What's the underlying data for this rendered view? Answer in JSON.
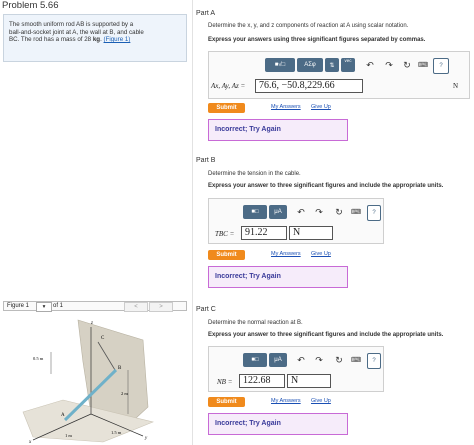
{
  "problem": {
    "title": "Problem 5.66",
    "text_line1": "The smooth uniform rod AB is supported by a",
    "text_line2": "ball-and-socket joint at A, the wall at B, and cable",
    "text_line3_a": "BC. The rod has a mass of 28",
    "text_line3_unit": "kg",
    "text_line3_b": ".",
    "figure_link": "(Figure 1)"
  },
  "figure": {
    "label": "Figure 1",
    "page": "1",
    "of": "of 1",
    "prev": "<",
    "next": ">",
    "labels": {
      "z": "z",
      "c": "C",
      "b": "B",
      "a": "A",
      "d1": "0.5 m",
      "d2": "2 m",
      "d3": "1 m",
      "d4": "1.5 m",
      "x": "x",
      "y": "y"
    }
  },
  "partA": {
    "title": "Part A",
    "description": "Determine the x, y, and z components of reaction at A using scalar notation.",
    "instruction": "Express your answers using three significant figures separated by commas.",
    "toolbar": {
      "templates": "■√□",
      "symbols": "ΑΣφ",
      "vec": "⇅",
      "vec2": "vec",
      "help": "?"
    },
    "label": "Ax, Ay, Az =",
    "value": "76.6, −50.8,229.66",
    "unit": "N",
    "submit": "Submit",
    "my_answers": "My Answers",
    "give_up": "Give Up",
    "feedback": "Incorrect; Try Again"
  },
  "partB": {
    "title": "Part B",
    "description": "Determine the tension in the cable.",
    "instruction": "Express your answer to three significant figures and include the appropriate units.",
    "toolbar": {
      "templates": "■□",
      "units": "μA",
      "help": "?"
    },
    "label": "TBC =",
    "value": "91.22",
    "unit": "N",
    "submit": "Submit",
    "my_answers": "My Answers",
    "give_up": "Give Up",
    "feedback": "Incorrect; Try Again"
  },
  "partC": {
    "title": "Part C",
    "description": "Determine the normal reaction at B.",
    "instruction": "Express your answer to three significant figures and include the appropriate units.",
    "toolbar": {
      "templates": "■□",
      "units": "μA",
      "help": "?"
    },
    "label": "NB =",
    "value": "122.68",
    "unit": "N",
    "submit": "Submit",
    "my_answers": "My Answers",
    "give_up": "Give Up",
    "feedback": "Incorrect; Try Again"
  },
  "colors": {
    "accent": "#4c6b86",
    "submit": "#f08a1c",
    "feedback_border": "#c86ad6"
  }
}
